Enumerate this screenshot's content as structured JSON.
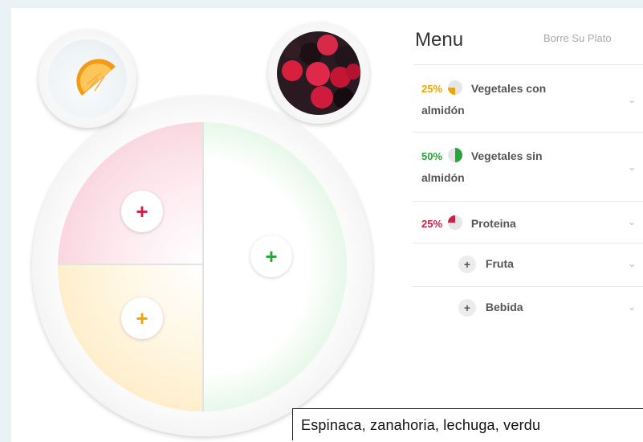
{
  "menu": {
    "title": "Menu",
    "clear_label": "Borre Su Plato",
    "items": [
      {
        "percent": "25%",
        "name_line1": "Vegetales con",
        "name_line2": "almidón",
        "percent_color": "#f2a400"
      },
      {
        "percent": "50%",
        "name_line1": "Vegetales sin",
        "name_line2": "almidón",
        "percent_color": "#27a438"
      },
      {
        "percent": "25%",
        "name_line1": "Proteina",
        "percent_color": "#cf1f45"
      },
      {
        "name_line1": "Fruta"
      },
      {
        "name_line1": "Bebida"
      }
    ]
  },
  "plate": {
    "add_symbol": "+",
    "sections": [
      {
        "key": "protein",
        "color": "#cf1f45"
      },
      {
        "key": "starchy_vegetables",
        "color": "#f2a400"
      },
      {
        "key": "non_starchy_vegetables",
        "color": "#27a438"
      }
    ]
  },
  "tooltip": {
    "text": "Espinaca, zanahoria, lechuga, verdu"
  },
  "icons": {
    "item_expand": "chevron-down-icon",
    "add": "plus-icon"
  }
}
